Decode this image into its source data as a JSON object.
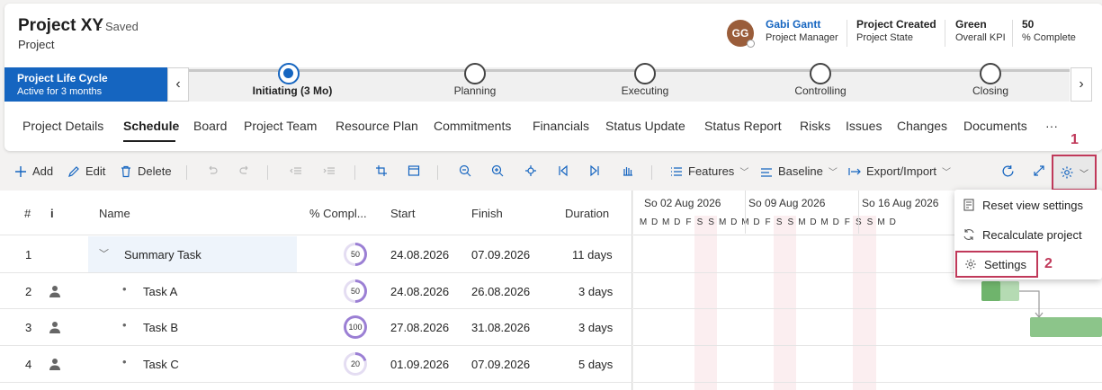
{
  "project": {
    "title": "Project XY",
    "saved": "- Saved",
    "type": "Project"
  },
  "avatar": {
    "initials": "GG",
    "color": "#9a5d3a"
  },
  "meta": [
    {
      "value": "Gabi Gantt",
      "label": "Project Manager",
      "color": "#1565c0"
    },
    {
      "value": "Project Created",
      "label": "Project State",
      "color": "#1f1f1f"
    },
    {
      "value": "Green",
      "label": "Overall KPI",
      "color": "#1f1f1f"
    },
    {
      "value": "50",
      "label": "% Complete",
      "color": "#1f1f1f"
    }
  ],
  "lifecycle": {
    "title": "Project Life Cycle",
    "subtitle": "Active for 3 months",
    "phases": [
      {
        "label": "Initiating  (3 Mo)",
        "active": true
      },
      {
        "label": "Planning",
        "active": false
      },
      {
        "label": "Executing",
        "active": false
      },
      {
        "label": "Controlling",
        "active": false
      },
      {
        "label": "Closing",
        "active": false
      }
    ]
  },
  "tabs": [
    "Project Details",
    "Schedule",
    "Board",
    "Project Team",
    "Resource Plan",
    "Commitments",
    "Financials",
    "Status Update",
    "Status Report",
    "Risks",
    "Issues",
    "Changes",
    "Documents",
    "···"
  ],
  "active_tab": "Schedule",
  "toolbar": {
    "add": "Add",
    "edit": "Edit",
    "delete": "Delete",
    "features": "Features",
    "baseline": "Baseline",
    "export_import": "Export/Import"
  },
  "columns": {
    "num": "#",
    "info": "i",
    "name": "Name",
    "complete": "% Compl...",
    "start": "Start",
    "finish": "Finish",
    "duration": "Duration"
  },
  "rows": [
    {
      "num": "1",
      "name": "Summary Task",
      "pct": "50",
      "pct_value": 50,
      "start": "24.08.2026",
      "finish": "07.09.2026",
      "duration": "11 days",
      "summary": true
    },
    {
      "num": "2",
      "name": "Task A",
      "pct": "50",
      "pct_value": 50,
      "start": "24.08.2026",
      "finish": "26.08.2026",
      "duration": "3 days",
      "summary": false
    },
    {
      "num": "3",
      "name": "Task B",
      "pct": "100",
      "pct_value": 100,
      "start": "27.08.2026",
      "finish": "31.08.2026",
      "duration": "3 days",
      "summary": false
    },
    {
      "num": "4",
      "name": "Task C",
      "pct": "20",
      "pct_value": 20,
      "start": "01.09.2026",
      "finish": "07.09.2026",
      "duration": "5 days",
      "summary": false
    }
  ],
  "gantt": {
    "weeks": [
      "So 02 Aug 2026",
      "So 09 Aug 2026",
      "So 16 Aug 2026"
    ],
    "days": [
      "M",
      "D",
      "M",
      "D",
      "F",
      "S",
      "S",
      "M",
      "D",
      "M",
      "D",
      "F",
      "S",
      "S",
      "M",
      "D",
      "M",
      "D",
      "F",
      "S",
      "S",
      "M",
      "D"
    ]
  },
  "menu": {
    "items": [
      {
        "label": "Reset view settings",
        "icon": "reset-icon"
      },
      {
        "label": "Recalculate project",
        "icon": "refresh-icon"
      },
      {
        "label": "Settings",
        "icon": "gear-icon"
      }
    ]
  },
  "callouts": {
    "one": "1",
    "two": "2"
  },
  "colors": {
    "accent": "#1565c0",
    "callout": "#c0395a",
    "bar": "#8cc58a",
    "progress": "#9b7fd4"
  }
}
